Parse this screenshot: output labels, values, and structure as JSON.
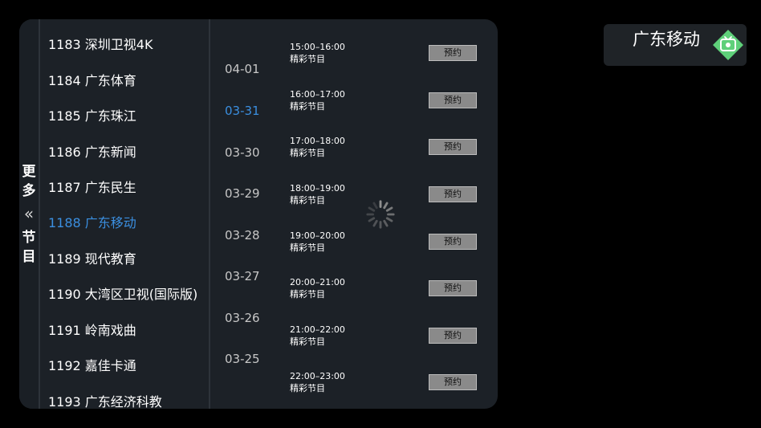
{
  "more_tab": {
    "chars": [
      "更",
      "多",
      "节",
      "目"
    ],
    "chevron": "«"
  },
  "channels": [
    {
      "label": "1183 深圳卫视4K"
    },
    {
      "label": "1184 广东体育"
    },
    {
      "label": "1185 广东珠江"
    },
    {
      "label": "1186 广东新闻"
    },
    {
      "label": "1187 广东民生"
    },
    {
      "label": "1188 广东移动",
      "selected": true
    },
    {
      "label": "1189 现代教育"
    },
    {
      "label": "1190 大湾区卫视(国际版)"
    },
    {
      "label": "1191 岭南戏曲"
    },
    {
      "label": "1192 嘉佳卡通"
    },
    {
      "label": "1193 广东经济科教"
    }
  ],
  "dates": [
    {
      "label": "04-01"
    },
    {
      "label": "03-31",
      "selected": true
    },
    {
      "label": "03-30"
    },
    {
      "label": "03-29"
    },
    {
      "label": "03-28"
    },
    {
      "label": "03-27"
    },
    {
      "label": "03-26"
    },
    {
      "label": "03-25"
    }
  ],
  "programs": [
    {
      "time": "15:00–16:00",
      "name": "精彩节目",
      "action": "预约"
    },
    {
      "time": "16:00–17:00",
      "name": "精彩节目",
      "action": "预约"
    },
    {
      "time": "17:00–18:00",
      "name": "精彩节目",
      "action": "预约"
    },
    {
      "time": "18:00–19:00",
      "name": "精彩节目",
      "action": "预约"
    },
    {
      "time": "19:00–20:00",
      "name": "精彩节目",
      "action": "预约"
    },
    {
      "time": "20:00–21:00",
      "name": "精彩节目",
      "action": "预约"
    },
    {
      "time": "21:00–22:00",
      "name": "精彩节目",
      "action": "预约"
    },
    {
      "time": "22:00–23:00",
      "name": "精彩节目",
      "action": "预约"
    }
  ],
  "current_channel": {
    "name": "广东移动",
    "icon": "tv-icon"
  },
  "colors": {
    "accent": "#3b8fe0",
    "panel": "#1c2127",
    "badge": "#5fd07a"
  },
  "loading": {
    "icon": "loading-spinner-icon"
  }
}
